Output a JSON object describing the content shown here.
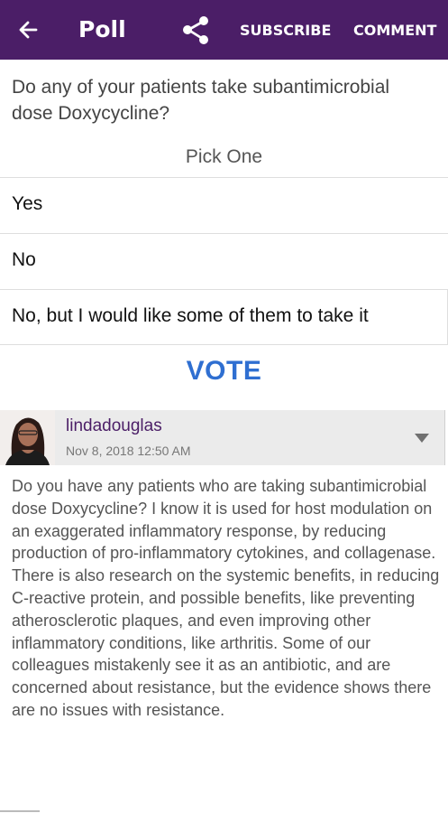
{
  "appbar": {
    "title": "Poll",
    "subscribe_label": "SUBSCRIBE",
    "comment_label": "COMMENT",
    "background_color": "#4b1e67",
    "back_icon": "arrow-left-icon",
    "share_icon": "share-icon"
  },
  "poll": {
    "question": "Do any of your patients take subantimicrobial dose Doxycycline?",
    "instruction": "Pick One",
    "options": [
      {
        "label": "Yes"
      },
      {
        "label": "No"
      },
      {
        "label": "No, but I would like some of them to take it"
      }
    ],
    "vote_label": "VOTE",
    "vote_color": "#2f6fd1"
  },
  "comment": {
    "username": "lindadouglas",
    "timestamp": "Nov 8, 2018 12:50 AM",
    "menu_icon": "chevron-down-icon",
    "body": "Do you have any patients who are taking subantimicrobial dose Doxycycline? I know it is used for host modulation on an exaggerated inflammatory response, by reducing production of pro-inflammatory cytokines, and collagenase. There is also research on the systemic benefits, in reducing C-reactive protein, and possible benefits, like preventing atherosclerotic plaques, and even improving other inflammatory conditions, like arthritis. Some of our colleagues mistakenly see it as an antibiotic, and are concerned about resistance, but the evidence shows there are no issues with resistance."
  }
}
